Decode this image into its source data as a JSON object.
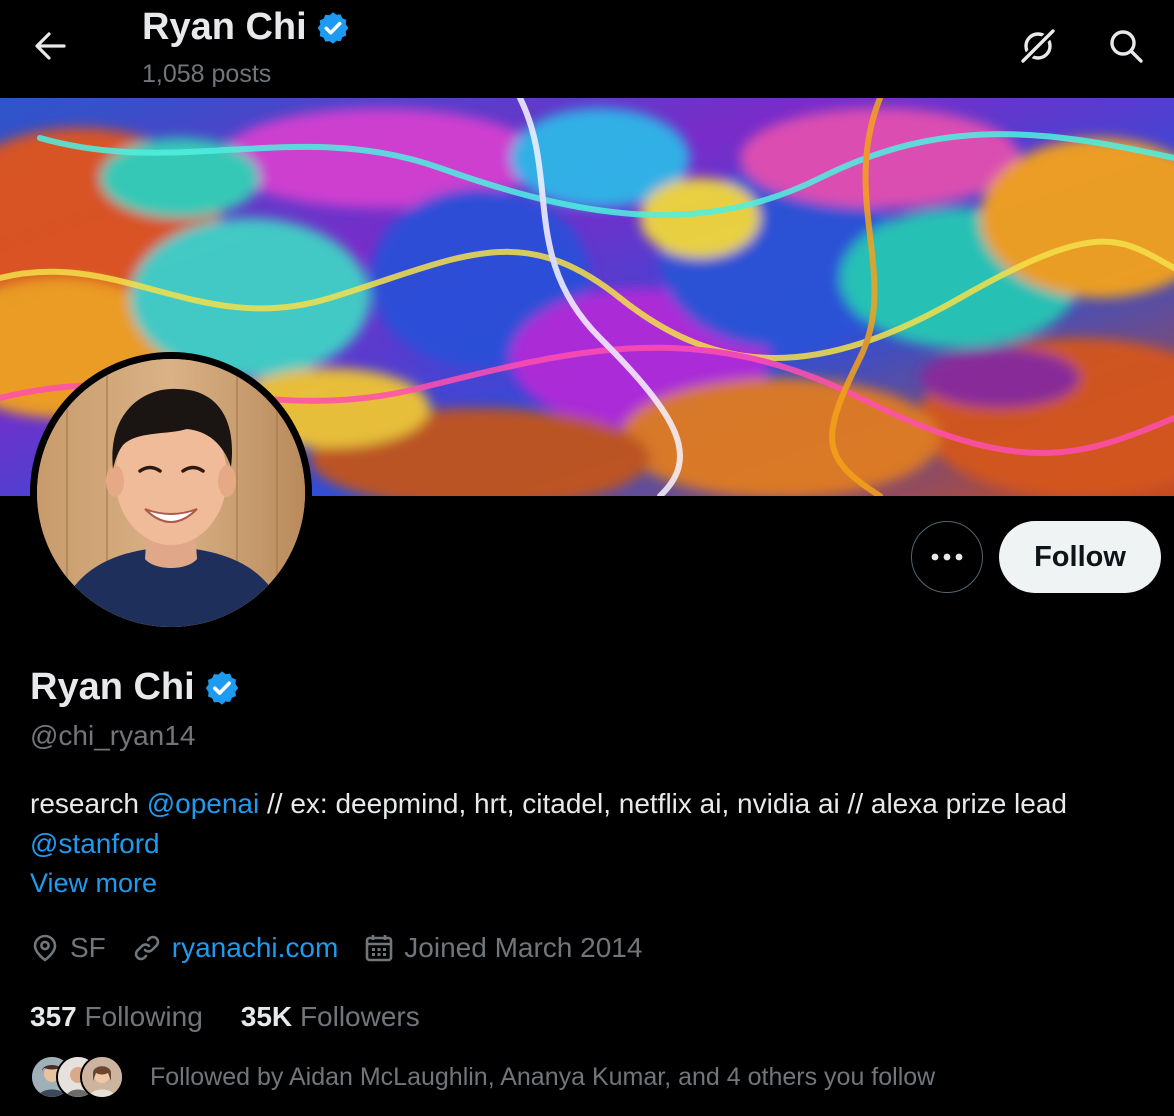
{
  "header": {
    "name": "Ryan Chi",
    "posts_count": "1,058 posts",
    "back_icon": "arrow-left-icon",
    "grok_icon": "grok-icon",
    "search_icon": "search-icon"
  },
  "profile": {
    "name": "Ryan Chi",
    "verified_icon": "verified-badge-icon",
    "handle": "@chi_ryan14",
    "bio": {
      "text1": "research ",
      "mention1": "@openai",
      "text2": " // ex: deepmind, hrt, citadel, netflix ai, nvidia ai // alexa prize lead ",
      "mention2": "@stanford"
    },
    "view_more": "View more",
    "location": "SF",
    "website": "ryanachi.com",
    "joined": "Joined March 2014"
  },
  "actions": {
    "more_icon": "more-horizontal-icon",
    "follow_label": "Follow"
  },
  "stats": {
    "following_count": "357",
    "following_label": "Following",
    "followers_count": "35K",
    "followers_label": "Followers"
  },
  "followed_by": "Followed by Aidan McLaughlin, Ananya Kumar, and 4 others you follow",
  "colors": {
    "background": "#000000",
    "text": "#e7e9ea",
    "secondary_text": "#71767b",
    "accent": "#1d9bf0",
    "follow_button_bg": "#eff3f4"
  }
}
